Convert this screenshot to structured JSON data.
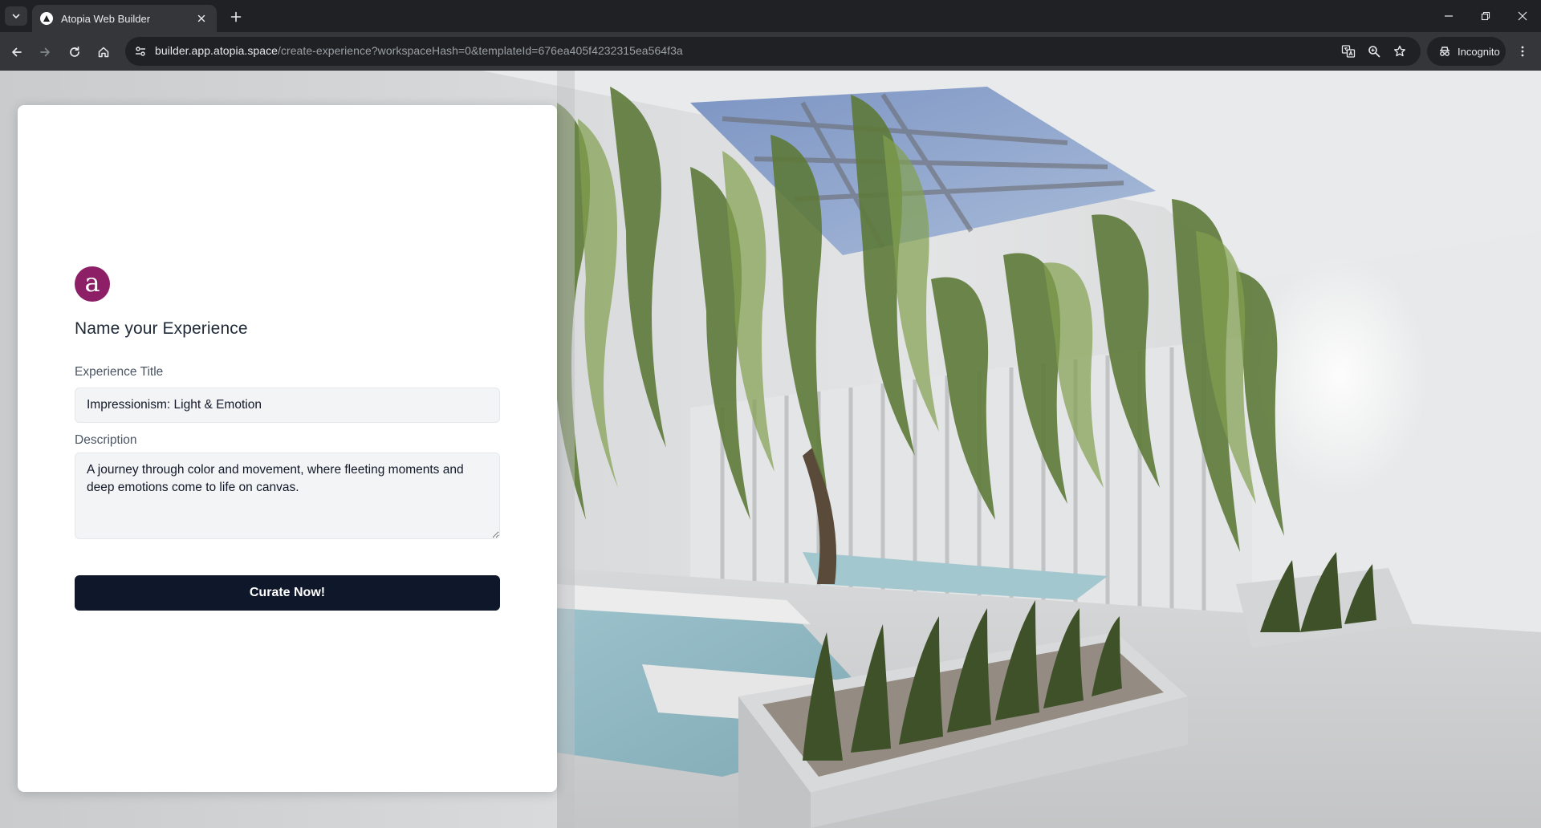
{
  "browser": {
    "tab_title": "Atopia Web Builder",
    "url_host": "builder.app.atopia.space",
    "url_path": "/create-experience?workspaceHash=0&templateId=676ea405f4232315ea564f3a",
    "profile_label": "Incognito"
  },
  "form": {
    "logo_letter": "a",
    "heading": "Name your Experience",
    "title_label": "Experience Title",
    "title_value": "Impressionism: Light & Emotion",
    "description_label": "Description",
    "description_value": "A journey through color and movement, where fleeting moments and deep emotions come to life on canvas.",
    "submit_label": "Curate Now!"
  },
  "colors": {
    "brand": "#8c1f66",
    "button": "#0f172a",
    "chrome_dark": "#202124",
    "chrome_toolbar": "#35363a"
  },
  "icons": {
    "tab_search": "chevron-down-icon",
    "favicon": "atopia-logo-icon",
    "tab_close": "close-icon",
    "new_tab": "plus-icon",
    "back": "arrow-left-icon",
    "forward": "arrow-right-icon",
    "reload": "reload-icon",
    "home": "home-icon",
    "site_info": "tune-icon",
    "translate": "translate-icon",
    "zoom": "zoom-icon",
    "bookmark": "star-icon",
    "incognito": "incognito-icon",
    "menu": "kebab-menu-icon"
  }
}
